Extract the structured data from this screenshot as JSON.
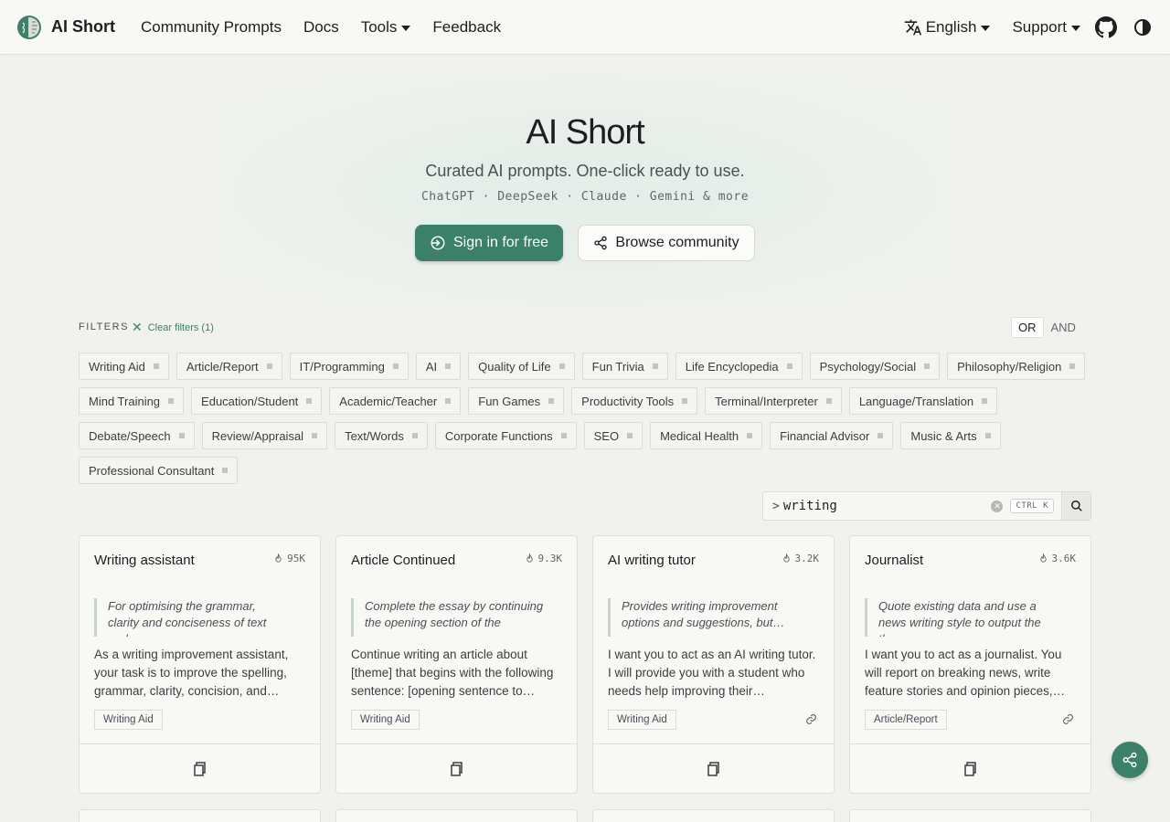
{
  "navbar": {
    "brand": "AI Short",
    "links": [
      "Community Prompts",
      "Docs",
      "Tools",
      "Feedback"
    ],
    "language": "English",
    "support": "Support"
  },
  "hero": {
    "title": "AI Short",
    "subtitle": "Curated AI prompts. One-click ready to use.",
    "models": "ChatGPT · DeepSeek · Claude · Gemini & more",
    "primary_button": "Sign in for free",
    "secondary_button": "Browse community"
  },
  "filters": {
    "label": "FILTERS",
    "clear": "Clear filters (1)",
    "logic_or": "OR",
    "logic_and": "AND",
    "tags": [
      "Writing Aid",
      "Article/Report",
      "IT/Programming",
      "AI",
      "Quality of Life",
      "Fun Trivia",
      "Life Encyclopedia",
      "Psychology/Social",
      "Philosophy/Religion",
      "Mind Training",
      "Education/Student",
      "Academic/Teacher",
      "Fun Games",
      "Productivity Tools",
      "Terminal/Interpreter",
      "Language/Translation",
      "Debate/Speech",
      "Review/Appraisal",
      "Text/Words",
      "Corporate Functions",
      "SEO",
      "Medical Health",
      "Financial Advisor",
      "Music & Arts",
      "Professional Consultant"
    ]
  },
  "search": {
    "prompt": ">",
    "value": "writing",
    "shortcut": "CTRL K"
  },
  "cards": [
    {
      "title": "Writing assistant",
      "count": "95K",
      "quote": "For optimising the grammar, clarity and conciseness of text and…",
      "body": "As a writing improvement assistant, your task is to improve the spelling, grammar, clarity, concision, and…",
      "tag": "Writing Aid",
      "has_link": false
    },
    {
      "title": "Article Continued",
      "count": "9.3K",
      "quote": "Complete the essay by continuing the opening section of the essay…",
      "body": "Continue writing an article about [theme] that begins with the following sentence: [opening sentence to…",
      "tag": "Writing Aid",
      "has_link": false
    },
    {
      "title": "AI writing tutor",
      "count": "3.2K",
      "quote": "Provides writing improvement options and suggestions, but…",
      "body": "I want you to act as an AI writing tutor. I will provide you with a student who needs help improving their…",
      "tag": "Writing Aid",
      "has_link": true
    },
    {
      "title": "Journalist",
      "count": "3.6K",
      "quote": "Quote existing data and use a news writing style to output the theme…",
      "body": "I want you to act as a journalist. You will report on breaking news, write feature stories and opinion pieces,…",
      "tag": "Article/Report",
      "has_link": true
    }
  ],
  "colors": {
    "accent": "#3b8068",
    "background": "#f1f1ed"
  }
}
